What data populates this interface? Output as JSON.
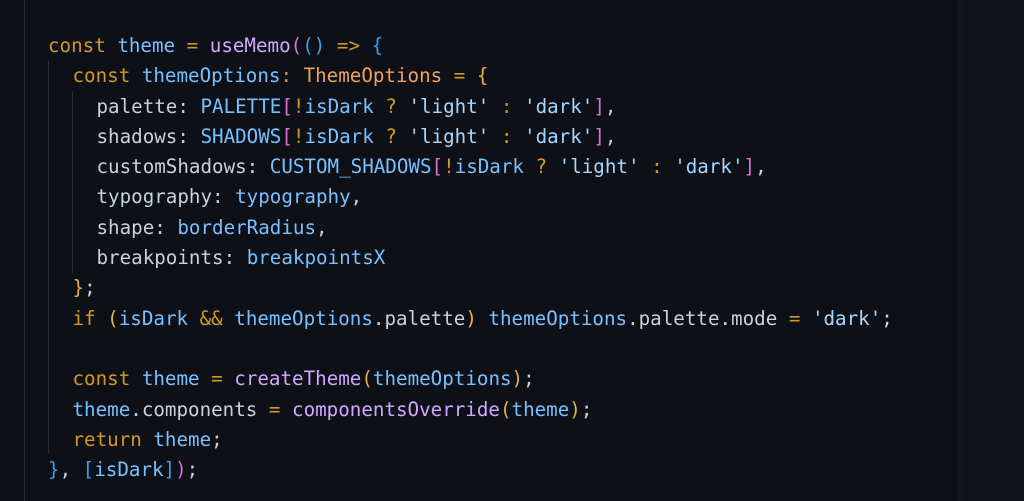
{
  "editor": {
    "theme": "dark",
    "background": "#0d1117",
    "colors": {
      "keyword": "#d29922",
      "identifier": "#79c0ff",
      "function": "#d2a8ff",
      "type": "#f0a05a",
      "string": "#a5d6ff",
      "property": "#c9d1d9",
      "bracket_level1": "#e3b341",
      "bracket_level2": "#da70d6",
      "bracket_level3": "#3c9fe8"
    },
    "lines": [
      {
        "tokens": [
          {
            "t": "const",
            "k": "kw"
          },
          {
            "t": " ",
            "k": "punc"
          },
          {
            "t": "theme",
            "k": "var"
          },
          {
            "t": " ",
            "k": "punc"
          },
          {
            "t": "=",
            "k": "op"
          },
          {
            "t": " ",
            "k": "punc"
          },
          {
            "t": "useMemo",
            "k": "fn"
          },
          {
            "t": "(",
            "k": "b2"
          },
          {
            "t": "()",
            "k": "b3"
          },
          {
            "t": " ",
            "k": "punc"
          },
          {
            "t": "=>",
            "k": "op"
          },
          {
            "t": " ",
            "k": "punc"
          },
          {
            "t": "{",
            "k": "b3"
          }
        ]
      },
      {
        "indent": 1,
        "tokens": [
          {
            "t": "const",
            "k": "kw"
          },
          {
            "t": " ",
            "k": "punc"
          },
          {
            "t": "themeOptions",
            "k": "var"
          },
          {
            "t": ": ",
            "k": "op"
          },
          {
            "t": "ThemeOptions",
            "k": "type"
          },
          {
            "t": " ",
            "k": "punc"
          },
          {
            "t": "=",
            "k": "op"
          },
          {
            "t": " ",
            "k": "punc"
          },
          {
            "t": "{",
            "k": "b1"
          }
        ]
      },
      {
        "indent": 2,
        "tokens": [
          {
            "t": "palette: ",
            "k": "prop"
          },
          {
            "t": "PALETTE",
            "k": "var"
          },
          {
            "t": "[",
            "k": "b2"
          },
          {
            "t": "!",
            "k": "op"
          },
          {
            "t": "isDark",
            "k": "var"
          },
          {
            "t": " ",
            "k": "punc"
          },
          {
            "t": "?",
            "k": "op"
          },
          {
            "t": " ",
            "k": "punc"
          },
          {
            "t": "'light'",
            "k": "str"
          },
          {
            "t": " ",
            "k": "punc"
          },
          {
            "t": ":",
            "k": "op"
          },
          {
            "t": " ",
            "k": "punc"
          },
          {
            "t": "'dark'",
            "k": "str"
          },
          {
            "t": "]",
            "k": "b2"
          },
          {
            "t": ",",
            "k": "punc"
          }
        ]
      },
      {
        "indent": 2,
        "tokens": [
          {
            "t": "shadows: ",
            "k": "prop"
          },
          {
            "t": "SHADOWS",
            "k": "var"
          },
          {
            "t": "[",
            "k": "b2"
          },
          {
            "t": "!",
            "k": "op"
          },
          {
            "t": "isDark",
            "k": "var"
          },
          {
            "t": " ",
            "k": "punc"
          },
          {
            "t": "?",
            "k": "op"
          },
          {
            "t": " ",
            "k": "punc"
          },
          {
            "t": "'light'",
            "k": "str"
          },
          {
            "t": " ",
            "k": "punc"
          },
          {
            "t": ":",
            "k": "op"
          },
          {
            "t": " ",
            "k": "punc"
          },
          {
            "t": "'dark'",
            "k": "str"
          },
          {
            "t": "]",
            "k": "b2"
          },
          {
            "t": ",",
            "k": "punc"
          }
        ]
      },
      {
        "indent": 2,
        "tokens": [
          {
            "t": "customShadows: ",
            "k": "prop"
          },
          {
            "t": "CUSTOM_SHADOWS",
            "k": "var"
          },
          {
            "t": "[",
            "k": "b2"
          },
          {
            "t": "!",
            "k": "op"
          },
          {
            "t": "isDark",
            "k": "var"
          },
          {
            "t": " ",
            "k": "punc"
          },
          {
            "t": "?",
            "k": "op"
          },
          {
            "t": " ",
            "k": "punc"
          },
          {
            "t": "'light'",
            "k": "str"
          },
          {
            "t": " ",
            "k": "punc"
          },
          {
            "t": ":",
            "k": "op"
          },
          {
            "t": " ",
            "k": "punc"
          },
          {
            "t": "'dark'",
            "k": "str"
          },
          {
            "t": "]",
            "k": "b2"
          },
          {
            "t": ",",
            "k": "punc"
          }
        ]
      },
      {
        "indent": 2,
        "tokens": [
          {
            "t": "typography: ",
            "k": "prop"
          },
          {
            "t": "typography",
            "k": "var"
          },
          {
            "t": ",",
            "k": "punc"
          }
        ]
      },
      {
        "indent": 2,
        "tokens": [
          {
            "t": "shape: ",
            "k": "prop"
          },
          {
            "t": "borderRadius",
            "k": "var"
          },
          {
            "t": ",",
            "k": "punc"
          }
        ]
      },
      {
        "indent": 2,
        "tokens": [
          {
            "t": "breakpoints: ",
            "k": "prop"
          },
          {
            "t": "breakpointsX",
            "k": "var"
          }
        ]
      },
      {
        "indent": 1,
        "tokens": [
          {
            "t": "}",
            "k": "b1"
          },
          {
            "t": ";",
            "k": "punc"
          }
        ]
      },
      {
        "indent": 1,
        "tokens": [
          {
            "t": "if",
            "k": "kw"
          },
          {
            "t": " ",
            "k": "punc"
          },
          {
            "t": "(",
            "k": "b1"
          },
          {
            "t": "isDark",
            "k": "var"
          },
          {
            "t": " ",
            "k": "punc"
          },
          {
            "t": "&&",
            "k": "op"
          },
          {
            "t": " ",
            "k": "punc"
          },
          {
            "t": "themeOptions",
            "k": "var"
          },
          {
            "t": ".palette",
            "k": "prop"
          },
          {
            "t": ")",
            "k": "b1"
          },
          {
            "t": " ",
            "k": "punc"
          },
          {
            "t": "themeOptions",
            "k": "var"
          },
          {
            "t": ".palette.mode",
            "k": "prop"
          },
          {
            "t": " ",
            "k": "punc"
          },
          {
            "t": "=",
            "k": "op"
          },
          {
            "t": " ",
            "k": "punc"
          },
          {
            "t": "'dark'",
            "k": "str"
          },
          {
            "t": ";",
            "k": "punc"
          }
        ]
      },
      {
        "indent": 0,
        "tokens": []
      },
      {
        "indent": 1,
        "tokens": [
          {
            "t": "const",
            "k": "kw"
          },
          {
            "t": " ",
            "k": "punc"
          },
          {
            "t": "theme",
            "k": "var"
          },
          {
            "t": " ",
            "k": "punc"
          },
          {
            "t": "=",
            "k": "op"
          },
          {
            "t": " ",
            "k": "punc"
          },
          {
            "t": "createTheme",
            "k": "fn"
          },
          {
            "t": "(",
            "k": "b1"
          },
          {
            "t": "themeOptions",
            "k": "var"
          },
          {
            "t": ")",
            "k": "b1"
          },
          {
            "t": ";",
            "k": "punc"
          }
        ]
      },
      {
        "indent": 1,
        "tokens": [
          {
            "t": "theme",
            "k": "var"
          },
          {
            "t": ".components",
            "k": "prop"
          },
          {
            "t": " ",
            "k": "punc"
          },
          {
            "t": "=",
            "k": "op"
          },
          {
            "t": " ",
            "k": "punc"
          },
          {
            "t": "componentsOverride",
            "k": "fn"
          },
          {
            "t": "(",
            "k": "b1"
          },
          {
            "t": "theme",
            "k": "var"
          },
          {
            "t": ")",
            "k": "b1"
          },
          {
            "t": ";",
            "k": "punc"
          }
        ]
      },
      {
        "indent": 1,
        "tokens": [
          {
            "t": "return",
            "k": "kw"
          },
          {
            "t": " ",
            "k": "punc"
          },
          {
            "t": "theme",
            "k": "var"
          },
          {
            "t": ";",
            "k": "punc"
          }
        ]
      },
      {
        "indent": 0,
        "tokens": [
          {
            "t": "}",
            "k": "b3"
          },
          {
            "t": ", ",
            "k": "punc"
          },
          {
            "t": "[",
            "k": "b3"
          },
          {
            "t": "isDark",
            "k": "var"
          },
          {
            "t": "]",
            "k": "b3"
          },
          {
            "t": ")",
            "k": "b2"
          },
          {
            "t": ";",
            "k": "punc"
          }
        ]
      }
    ]
  }
}
